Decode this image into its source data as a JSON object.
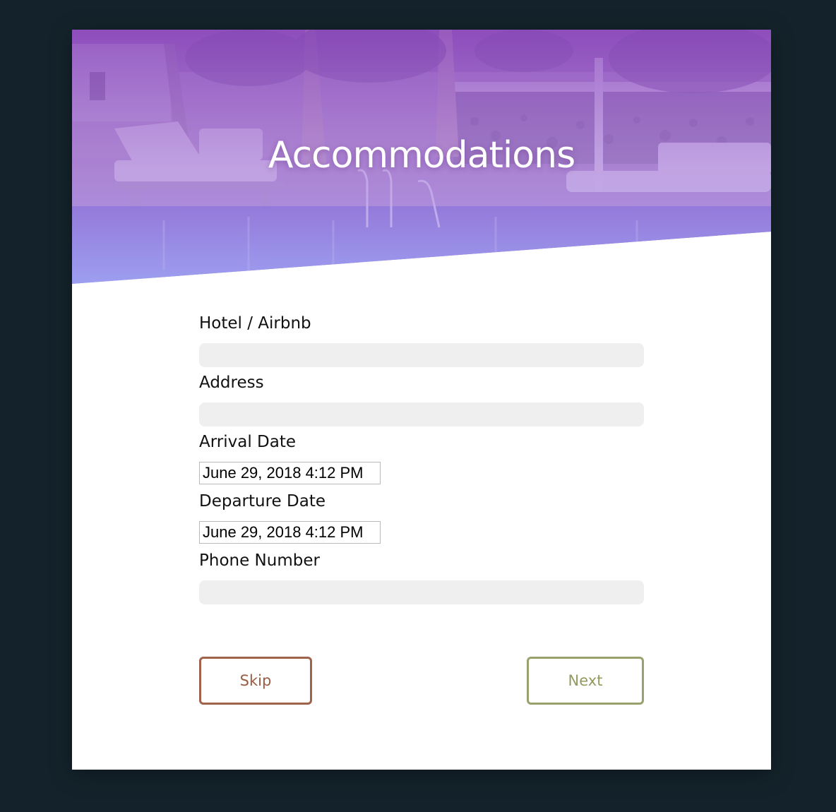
{
  "header": {
    "title": "Accommodations"
  },
  "form": {
    "fields": [
      {
        "label": "Hotel / Airbnb",
        "type": "text",
        "value": ""
      },
      {
        "label": "Address",
        "type": "text",
        "value": ""
      },
      {
        "label": "Arrival Date",
        "type": "datetime",
        "value": "June 29, 2018 4:12 PM"
      },
      {
        "label": "Departure Date",
        "type": "datetime",
        "value": "June 29, 2018 4:12 PM"
      },
      {
        "label": "Phone Number",
        "type": "text",
        "value": ""
      }
    ]
  },
  "buttons": {
    "skip_label": "Skip",
    "next_label": "Next"
  },
  "colors": {
    "background": "#14232b",
    "hero_overlay_top": "#8e4fc0",
    "hero_overlay_bottom": "#a98ff0",
    "skip_border": "#a0624a",
    "next_border": "#9aa06e",
    "input_fill": "#efefef"
  }
}
